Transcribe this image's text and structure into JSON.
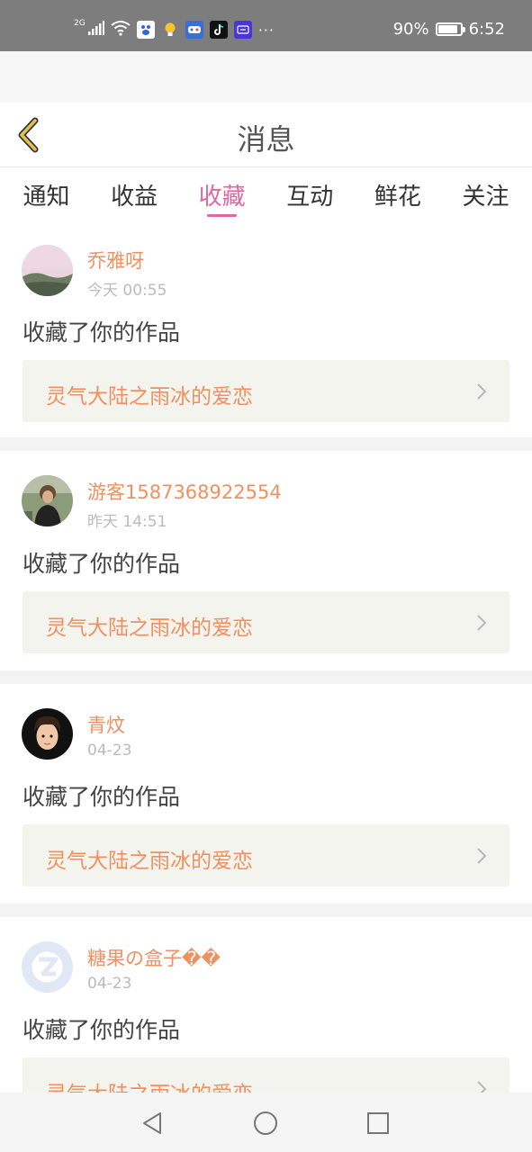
{
  "status_bar": {
    "network": "2G",
    "battery": "90%",
    "battery_level": 0.9,
    "time": "6:52",
    "app_icons": [
      "wifi-icon",
      "baidu-app-icon",
      "bulb-app-icon",
      "game-app-icon",
      "tiktok-app-icon",
      "app-icon"
    ],
    "more": "···"
  },
  "header": {
    "title": "消息",
    "back_icon": "chevron-left-icon",
    "accent": "#e2c24a"
  },
  "tabs": [
    {
      "label": "通知",
      "active": false
    },
    {
      "label": "收益",
      "active": false
    },
    {
      "label": "收藏",
      "active": true
    },
    {
      "label": "互动",
      "active": false
    },
    {
      "label": "鲜花",
      "active": false
    },
    {
      "label": "关注",
      "active": false
    }
  ],
  "colors": {
    "active_tab": "#e0679f",
    "username": "#f09060",
    "work_title": "#f09060",
    "work_bg": "#f4f4ee"
  },
  "messages": [
    {
      "username": "乔雅呀",
      "time": "今天 00:55",
      "action": "收藏了你的作品",
      "work_title": "灵气大陆之雨冰的爱恋"
    },
    {
      "username": "游客1587368922554",
      "time": "昨天 14:51",
      "action": "收藏了你的作品",
      "work_title": "灵气大陆之雨冰的爱恋"
    },
    {
      "username": "青炆",
      "time": "04-23",
      "action": "收藏了你的作品",
      "work_title": "灵气大陆之雨冰的爱恋"
    },
    {
      "username": "糖果の盒子��",
      "time": "04-23",
      "action": "收藏了你的作品",
      "work_title": "灵气大陆之雨冰的爱恋"
    }
  ],
  "nav": {
    "back": "triangle-back-icon",
    "home": "circle-home-icon",
    "recents": "square-recents-icon"
  }
}
